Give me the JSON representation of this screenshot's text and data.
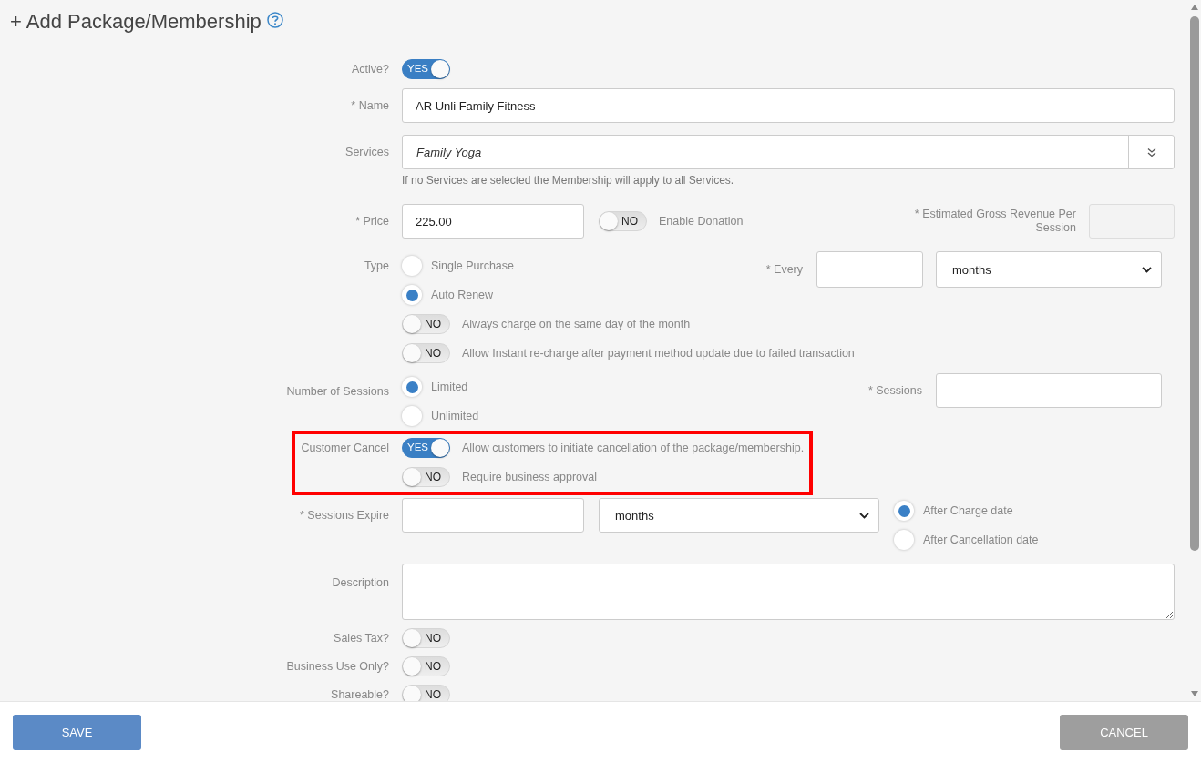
{
  "title": "+ Add Package/Membership",
  "active": {
    "label": "Active?",
    "on": true,
    "text": "YES"
  },
  "name": {
    "label": "* Name",
    "value": "AR Unli Family Fitness"
  },
  "services": {
    "label": "Services",
    "value": "Family Yoga",
    "hint": "If no Services are selected the Membership will apply to all Services."
  },
  "price": {
    "label": "* Price",
    "value": "225.00",
    "donation": {
      "on": false,
      "text": "NO",
      "label": "Enable Donation"
    },
    "revenue_label": "* Estimated Gross Revenue Per Session"
  },
  "type": {
    "label": "Type",
    "options": [
      {
        "label": "Single Purchase",
        "selected": false
      },
      {
        "label": "Auto Renew",
        "selected": true
      }
    ],
    "every_label": "* Every",
    "every_unit": "months"
  },
  "charge_options": [
    {
      "on": false,
      "text": "NO",
      "label": "Always charge on the same day of the month"
    },
    {
      "on": false,
      "text": "NO",
      "label": "Allow Instant re-charge after payment method update due to failed transaction"
    }
  ],
  "sessions": {
    "label": "Number of Sessions",
    "options": [
      {
        "label": "Limited",
        "selected": true
      },
      {
        "label": "Unlimited",
        "selected": false
      }
    ],
    "count_label": "* Sessions"
  },
  "customer_cancel": {
    "label": "Customer Cancel",
    "highlighted": true,
    "toggles": [
      {
        "on": true,
        "text": "YES",
        "label": "Allow customers to initiate cancellation of the package/membership."
      },
      {
        "on": false,
        "text": "NO",
        "label": "Require business approval"
      }
    ]
  },
  "expire": {
    "label": "* Sessions Expire",
    "unit": "months",
    "options": [
      {
        "label": "After Charge date",
        "selected": true
      },
      {
        "label": "After Cancellation date",
        "selected": false
      }
    ]
  },
  "description": {
    "label": "Description"
  },
  "flags": [
    {
      "label": "Sales Tax?",
      "on": false,
      "text": "NO"
    },
    {
      "label": "Business Use Only?",
      "on": false,
      "text": "NO"
    },
    {
      "label": "Shareable?",
      "on": false,
      "text": "NO"
    }
  ],
  "buttons": [
    {
      "label": "SAVE",
      "kind": "primary"
    },
    {
      "label": "CANCEL",
      "kind": "secondary"
    }
  ]
}
